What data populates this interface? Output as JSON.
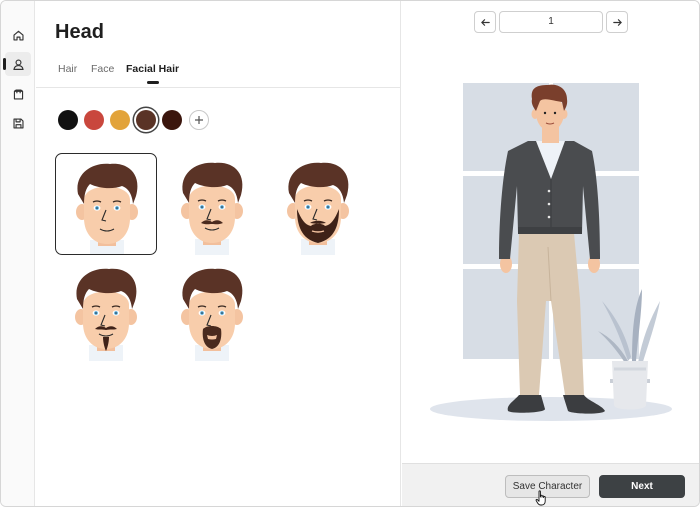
{
  "editor": {
    "title": "Head",
    "tabs": [
      {
        "label": "Hair",
        "active": false
      },
      {
        "label": "Face",
        "active": false
      },
      {
        "label": "Facial Hair",
        "active": true
      }
    ],
    "colors": [
      {
        "hex": "#111111",
        "selected": false
      },
      {
        "hex": "#c9473d",
        "selected": false
      },
      {
        "hex": "#e2a33a",
        "selected": false
      },
      {
        "hex": "#5a3326",
        "selected": true
      },
      {
        "hex": "#3b160d",
        "selected": false
      }
    ],
    "styles": [
      {
        "type": "none",
        "selected": true
      },
      {
        "type": "mustache",
        "selected": false
      },
      {
        "type": "full-beard",
        "selected": false
      },
      {
        "type": "goatee-mustache",
        "selected": false
      },
      {
        "type": "circle-beard",
        "selected": false
      }
    ]
  },
  "pager": {
    "value": "1"
  },
  "footer": {
    "save_label": "Save Character",
    "next_label": "Next"
  },
  "icons": {
    "rail": [
      "home-icon",
      "user-icon",
      "outfit-icon",
      "save-icon"
    ],
    "pager": [
      "arrow-left-icon",
      "arrow-right-icon"
    ],
    "add": "plus-icon"
  }
}
